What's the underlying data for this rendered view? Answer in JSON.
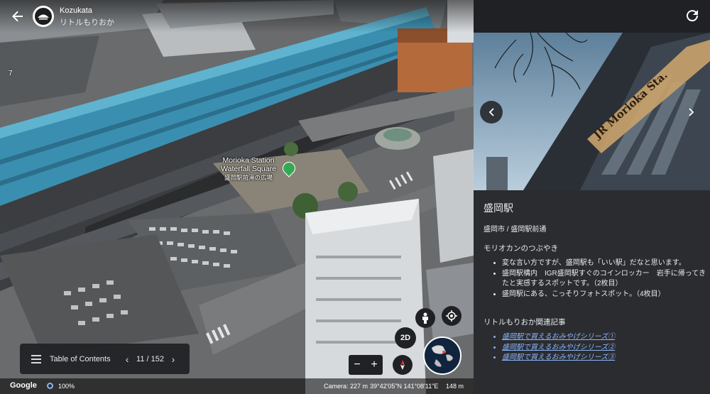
{
  "header": {
    "project_name": "Kozukata",
    "project_subtitle": "リトルもりおか"
  },
  "map": {
    "poi_label_en_1": "Morioka Station",
    "poi_label_en_2": "Waterfall Square",
    "poi_label_jp": "盛岡駅前滝の広場",
    "edge_label": "7",
    "toc": {
      "label": "Table of Contents",
      "count": "11 / 152"
    },
    "controls": {
      "view_mode": "2D",
      "zoom_in": "+",
      "zoom_out": "−"
    },
    "status": {
      "brand": "Google",
      "loading_percent": "100%",
      "camera": "Camera: 227 m",
      "coordinates": "39°42'05\"N 141°08'11\"E",
      "scale": "148 m"
    }
  },
  "panel": {
    "place_title": "盛岡駅",
    "address": "盛岡市 / 盛岡駅前通",
    "section1_title": "モリオカンのつぶやき",
    "bullets": [
      "変な言い方ですが、盛岡駅も「いい駅」だなと思います。",
      "盛岡駅構内　IGR盛岡駅すぐのコインロッカー　岩手に帰ってきたと実感するスポットです。（2枚目）",
      "盛岡駅にある、こっそりフォトスポット。（4枚目）"
    ],
    "section2_title": "リトルもりおか関連記事",
    "links": [
      "盛岡駅で買えるおみやげシリーズ①",
      "盛岡駅で買えるおみやげシリーズ②",
      "盛岡駅で買えるおみやげシリーズ③"
    ],
    "photo_sign_text": "JR Morioka Sta."
  }
}
